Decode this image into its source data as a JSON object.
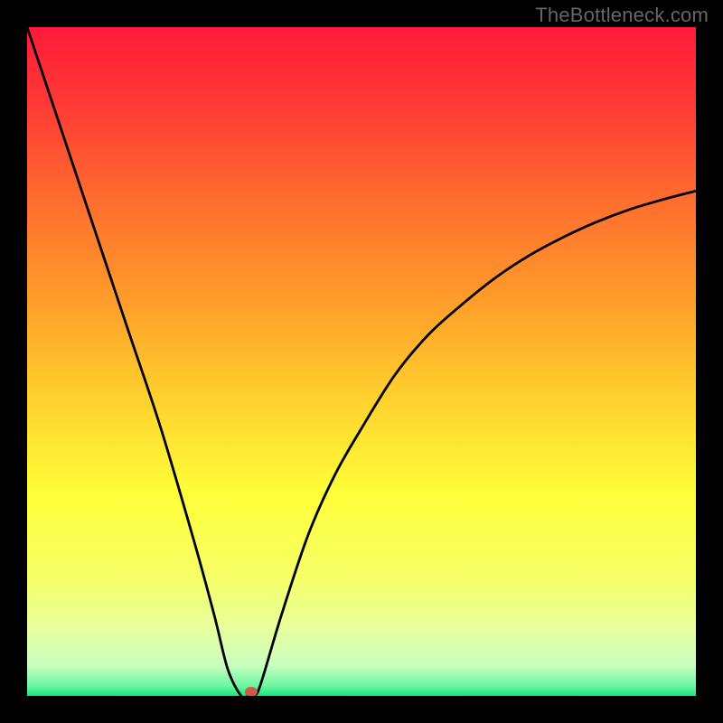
{
  "watermark": "TheBottleneck.com",
  "chart_data": {
    "type": "line",
    "title": "",
    "xlabel": "",
    "ylabel": "",
    "xlim": [
      0,
      100
    ],
    "ylim": [
      0,
      100
    ],
    "series": [
      {
        "name": "curve",
        "x": [
          0,
          5,
          10,
          15,
          20,
          25,
          28,
          30,
          32,
          33,
          34,
          35,
          38,
          42,
          46,
          50,
          55,
          60,
          65,
          70,
          75,
          80,
          85,
          90,
          95,
          100
        ],
        "values": [
          100,
          85,
          70,
          55,
          40,
          23,
          12,
          4,
          0,
          0,
          0,
          2,
          12,
          24,
          33,
          40,
          48,
          54,
          58.5,
          62.5,
          65.8,
          68.5,
          70.8,
          72.7,
          74.2,
          75.5
        ]
      }
    ],
    "marker": {
      "x": 33.5,
      "y": 0.6,
      "color": "#d05a4a"
    },
    "gradient_stops": [
      {
        "offset": 0.0,
        "color": "#ff1a3a"
      },
      {
        "offset": 0.12,
        "color": "#ff3b35"
      },
      {
        "offset": 0.25,
        "color": "#ff6a2f"
      },
      {
        "offset": 0.4,
        "color": "#ff9a2a"
      },
      {
        "offset": 0.55,
        "color": "#ffcf2d"
      },
      {
        "offset": 0.7,
        "color": "#ffff3a"
      },
      {
        "offset": 0.82,
        "color": "#f6ff66"
      },
      {
        "offset": 0.9,
        "color": "#e8ff9d"
      },
      {
        "offset": 0.955,
        "color": "#c8ffc0"
      },
      {
        "offset": 0.985,
        "color": "#6cf7a2"
      },
      {
        "offset": 1.0,
        "color": "#17e67a"
      }
    ]
  }
}
